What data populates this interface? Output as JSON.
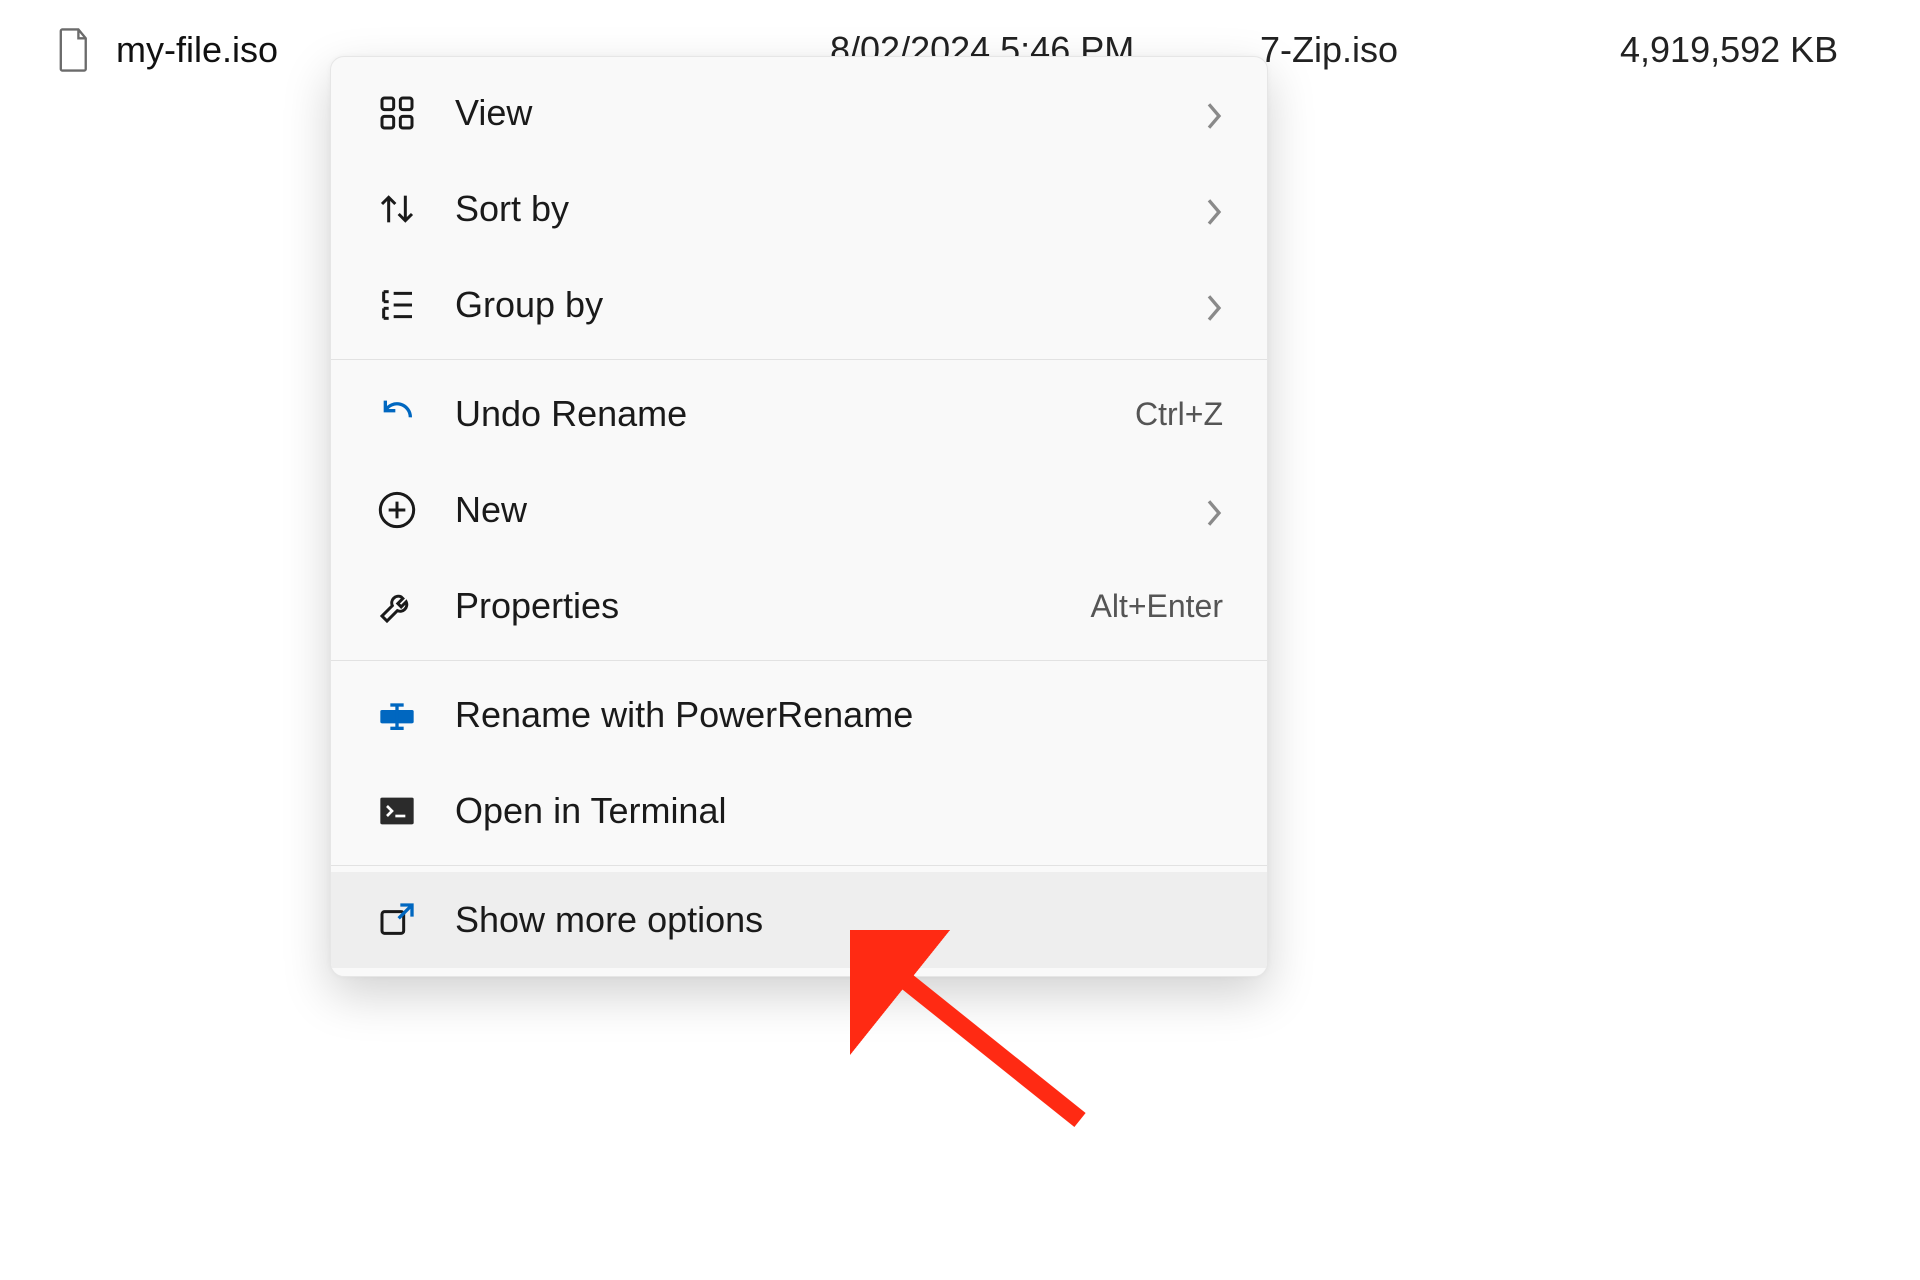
{
  "file_row": {
    "name": "my-file.iso",
    "date": "8/02/2024 5:46 PM",
    "type": "7-Zip.iso",
    "size": "4,919,592 KB"
  },
  "context_menu": {
    "items": [
      {
        "label": "View",
        "icon": "grid-icon",
        "has_submenu": true
      },
      {
        "label": "Sort by",
        "icon": "sort-icon",
        "has_submenu": true
      },
      {
        "label": "Group by",
        "icon": "group-icon",
        "has_submenu": true
      }
    ],
    "items2": [
      {
        "label": "Undo Rename",
        "icon": "undo-icon",
        "shortcut": "Ctrl+Z"
      },
      {
        "label": "New",
        "icon": "plus-icon",
        "has_submenu": true
      },
      {
        "label": "Properties",
        "icon": "wrench-icon",
        "shortcut": "Alt+Enter"
      }
    ],
    "items3": [
      {
        "label": "Rename with PowerRename",
        "icon": "powerrename-icon"
      },
      {
        "label": "Open in Terminal",
        "icon": "terminal-icon"
      }
    ],
    "items4": [
      {
        "label": "Show more options",
        "icon": "expand-icon",
        "hovered": true
      }
    ]
  },
  "annotation": {
    "type": "arrow",
    "color": "#ff2a13"
  }
}
